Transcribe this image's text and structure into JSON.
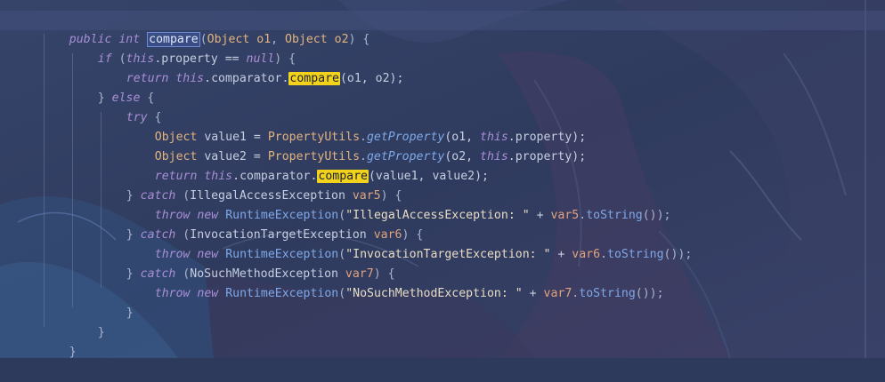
{
  "code": {
    "l1": {
      "public": "public",
      "int": "int",
      "compare": "compare",
      "open": "(",
      "t1": "Object",
      "p1": "o1",
      "comma": ", ",
      "t2": "Object",
      "p2": "o2",
      "close": ") {"
    },
    "l2": {
      "if": "if",
      "open": " (",
      "this": "this",
      "dot": ".property == ",
      "null": "null",
      "close": ") {"
    },
    "l3": {
      "return": "return",
      "this": "this",
      "dot": ".comparator.",
      "compare": "compare",
      "args": "(o1, o2);"
    },
    "l4": {
      "close": "} ",
      "else": "else",
      "open": " {"
    },
    "l5": {
      "try": "try",
      "open": " {"
    },
    "l6": {
      "type": "Object",
      "decl": " value1 = ",
      "cls": "PropertyUtils",
      "dot": ".",
      "method": "getProperty",
      "args1": "(o1, ",
      "this": "this",
      "rest": ".property);"
    },
    "l7": {
      "type": "Object",
      "decl": " value2 = ",
      "cls": "PropertyUtils",
      "dot": ".",
      "method": "getProperty",
      "args1": "(o2, ",
      "this": "this",
      "rest": ".property);"
    },
    "l8": {
      "return": "return",
      "this": "this",
      "dot": ".comparator.",
      "compare": "compare",
      "args": "(value1, value2);"
    },
    "l9": {
      "close": "} ",
      "catch": "catch",
      "open": " (",
      "exc": "IllegalAccessException",
      "var": " var5",
      "rest": ") {"
    },
    "l10": {
      "throw": "throw",
      "new": "new",
      "cls": "RuntimeException",
      "open": "(",
      "str": "\"IllegalAccessException: \"",
      "plus": " + ",
      "var": "var5",
      "dot": ".",
      "method": "toString",
      "rest": "());"
    },
    "l11": {
      "close": "} ",
      "catch": "catch",
      "open": " (",
      "exc": "InvocationTargetException",
      "var": " var6",
      "rest": ") {"
    },
    "l12": {
      "throw": "throw",
      "new": "new",
      "cls": "RuntimeException",
      "open": "(",
      "str": "\"InvocationTargetException: \"",
      "plus": " + ",
      "var": "var6",
      "dot": ".",
      "method": "toString",
      "rest": "());"
    },
    "l13": {
      "close": "} ",
      "catch": "catch",
      "open": " (",
      "exc": "NoSuchMethodException",
      "var": " var7",
      "rest": ") {"
    },
    "l14": {
      "throw": "throw",
      "new": "new",
      "cls": "RuntimeException",
      "open": "(",
      "str": "\"NoSuchMethodException: \"",
      "plus": " + ",
      "var": "var7",
      "dot": ".",
      "method": "toString",
      "rest": "());"
    },
    "l15": {
      "close": "}"
    },
    "l16": {
      "close": "}"
    },
    "l17": {
      "close": "}"
    }
  },
  "colors": {
    "background": "#2e3a5c",
    "keyword": "#a98fd6",
    "method": "#7fa8e8",
    "type": "#e3b47e",
    "string": "#e8dcc4",
    "highlight": "#f2d21b"
  }
}
